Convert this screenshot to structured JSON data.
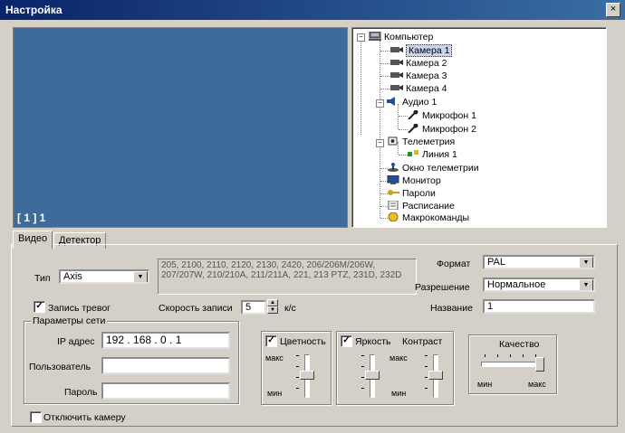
{
  "window": {
    "title": "Настройка",
    "close_glyph": "×"
  },
  "preview": {
    "label": "[ 1 ] 1"
  },
  "tree": {
    "root": "Компьютер",
    "cameras": [
      "Камера 1",
      "Камера 2",
      "Камера 3",
      "Камера 4"
    ],
    "audio": "Аудио 1",
    "microphones": [
      "Микрофон 1",
      "Микрофон 2"
    ],
    "telemetry": "Телеметрия",
    "line": "Линия 1",
    "others": [
      "Окно телеметрии",
      "Монитор",
      "Пароли",
      "Расписание",
      "Макрокоманды"
    ],
    "selected": "Камера 1"
  },
  "tabs": [
    "Видео",
    "Детектор"
  ],
  "video": {
    "type_label": "Тип",
    "type_value": "Axis",
    "models_text": "205, 2100, 2110, 2120, 2130, 2420, 206/206M/206W, 207/207W, 210/210A, 211/211A, 221, 213 PTZ, 231D, 232D",
    "format_label": "Формат",
    "format_value": "PAL",
    "resolution_label": "Разрешение",
    "resolution_value": "Нормальное",
    "record_alarms_label": "Запись тревог",
    "record_speed_label": "Скорость записи",
    "record_speed_value": "5",
    "record_speed_unit": "к/с",
    "name_label": "Название",
    "name_value": "1",
    "network_group": "Параметры сети",
    "ip_label": "IP адрес",
    "ip_value": "192 . 168 .  0  .  1",
    "user_label": "Пользователь",
    "user_value": "",
    "password_label": "Пароль",
    "password_value": "",
    "color_label": "Цветность",
    "brightness_label": "Яркость",
    "contrast_label": "Контраст",
    "quality_label": "Качество",
    "max_label": "макс",
    "min_label": "мин",
    "disable_camera_label": "Отключить камеру",
    "check_mark": "✓"
  }
}
